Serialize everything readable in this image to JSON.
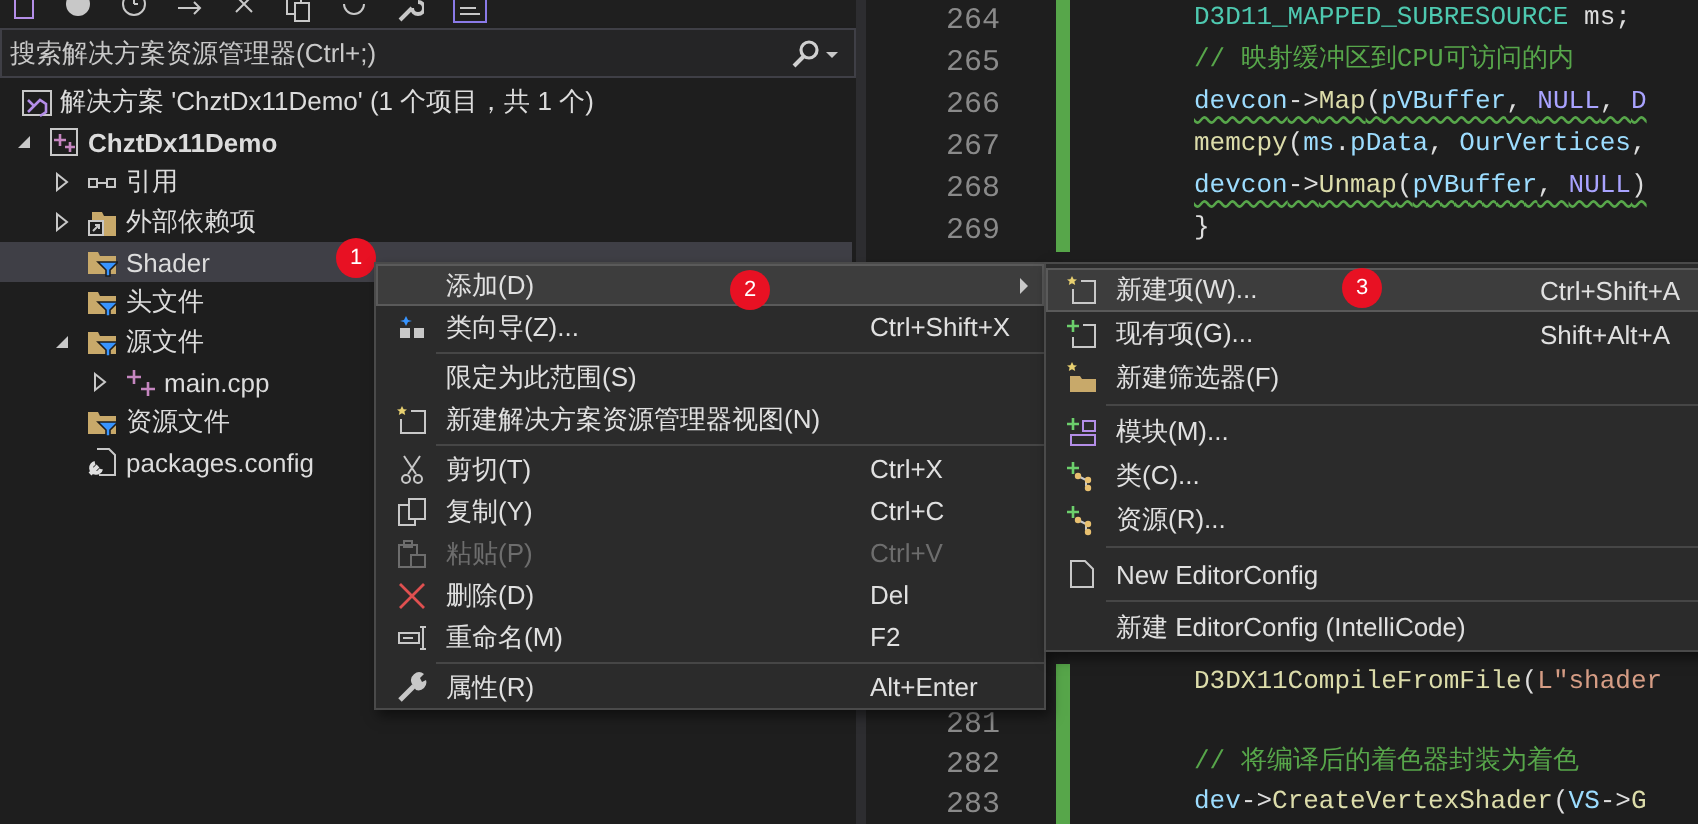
{
  "search": {
    "placeholder": "搜索解决方案资源管理器(Ctrl+;)"
  },
  "tree": [
    {
      "label": "解决方案 'ChztDx11Demo' (1 个项目，共 1 个)",
      "kind": "solution",
      "selected": false,
      "children": [
        {
          "label": "ChztDx11Demo",
          "kind": "project",
          "expanded": true,
          "selected": false,
          "children": [
            {
              "label": "引用",
              "kind": "references",
              "expanded": false,
              "selected": false
            },
            {
              "label": "外部依赖项",
              "kind": "external",
              "expanded": false,
              "selected": false
            },
            {
              "label": "Shader",
              "kind": "filter",
              "selected": true,
              "badge": "1"
            },
            {
              "label": "头文件",
              "kind": "filter",
              "selected": false
            },
            {
              "label": "源文件",
              "kind": "filter",
              "expanded": true,
              "selected": false,
              "children": [
                {
                  "label": "main.cpp",
                  "kind": "cpp",
                  "expanded": false,
                  "selected": false
                }
              ]
            },
            {
              "label": "资源文件",
              "kind": "filter",
              "selected": false
            },
            {
              "label": "packages.config",
              "kind": "config",
              "selected": false
            }
          ]
        }
      ]
    }
  ],
  "editor": {
    "blocks": [
      {
        "lines": [
          {
            "number": "264",
            "changed": true,
            "warning": false,
            "code": [
              {
                "kind": "type",
                "text": "D3D11_MAPPED_SUBRESOURCE"
              },
              {
                "kind": "plain",
                "text": " ms;"
              }
            ]
          },
          {
            "number": "265",
            "changed": true,
            "warning": false,
            "code": [
              {
                "kind": "comment",
                "text": "// 映射缓冲区到CPU可访问的内"
              }
            ]
          },
          {
            "number": "266",
            "changed": true,
            "warning": true,
            "code": [
              {
                "kind": "var",
                "text": "devcon"
              },
              {
                "kind": "plain",
                "text": "->"
              },
              {
                "kind": "func",
                "text": "Map"
              },
              {
                "kind": "plain",
                "text": "("
              },
              {
                "kind": "var",
                "text": "pVBuffer"
              },
              {
                "kind": "plain",
                "text": ", "
              },
              {
                "kind": "macro",
                "text": "NULL"
              },
              {
                "kind": "plain",
                "text": ", "
              },
              {
                "kind": "macro",
                "text": "D"
              }
            ]
          },
          {
            "number": "267",
            "changed": true,
            "warning": false,
            "code": [
              {
                "kind": "func",
                "text": "memcpy"
              },
              {
                "kind": "plain",
                "text": "("
              },
              {
                "kind": "var",
                "text": "ms"
              },
              {
                "kind": "plain",
                "text": "."
              },
              {
                "kind": "var",
                "text": "pData"
              },
              {
                "kind": "plain",
                "text": ", "
              },
              {
                "kind": "var",
                "text": "OurVertices"
              },
              {
                "kind": "plain",
                "text": ","
              }
            ]
          },
          {
            "number": "268",
            "changed": true,
            "warning": true,
            "code": [
              {
                "kind": "var",
                "text": "devcon"
              },
              {
                "kind": "plain",
                "text": "->"
              },
              {
                "kind": "func",
                "text": "Unmap"
              },
              {
                "kind": "plain",
                "text": "("
              },
              {
                "kind": "var",
                "text": "pVBuffer"
              },
              {
                "kind": "plain",
                "text": ", "
              },
              {
                "kind": "macro",
                "text": "NULL"
              },
              {
                "kind": "plain",
                "text": ")"
              }
            ]
          },
          {
            "number": "269",
            "changed": true,
            "warning": false,
            "code": [
              {
                "kind": "plain",
                "text": "}"
              }
            ]
          }
        ]
      },
      {
        "lines": [
          {
            "changed": true,
            "warning": false,
            "code": [
              {
                "kind": "func",
                "text": "D3DX11CompileFromFile"
              },
              {
                "kind": "plain",
                "text": "("
              },
              {
                "kind": "string",
                "text": "L\"shader"
              }
            ]
          },
          {
            "number": "281",
            "changed": true
          },
          {
            "number": "282",
            "changed": true,
            "warning": false,
            "code": [
              {
                "kind": "comment",
                "text": "// 将编译后的着色器封装为着色"
              }
            ]
          },
          {
            "number": "283",
            "changed": true,
            "warning": false,
            "code": [
              {
                "kind": "var",
                "text": "dev"
              },
              {
                "kind": "plain",
                "text": "->"
              },
              {
                "kind": "func",
                "text": "CreateVertexShader"
              },
              {
                "kind": "plain",
                "text": "("
              },
              {
                "kind": "var",
                "text": "VS"
              },
              {
                "kind": "plain",
                "text": "->"
              },
              {
                "kind": "func",
                "text": "G"
              }
            ]
          }
        ]
      }
    ]
  },
  "context_menu": {
    "items": [
      {
        "kind": "submenu",
        "label": "添加(D)",
        "selected": true,
        "disabled": false,
        "badge": "2"
      },
      {
        "kind": "item",
        "label": "类向导(Z)...",
        "shortcut": "Ctrl+Shift+X",
        "selected": false,
        "disabled": false
      },
      {
        "kind": "separator"
      },
      {
        "kind": "item",
        "label": "限定为此范围(S)",
        "selected": false,
        "disabled": false
      },
      {
        "kind": "item",
        "label": "新建解决方案资源管理器视图(N)",
        "selected": false,
        "disabled": false
      },
      {
        "kind": "separator"
      },
      {
        "kind": "item",
        "label": "剪切(T)",
        "shortcut": "Ctrl+X",
        "selected": false,
        "disabled": false
      },
      {
        "kind": "item",
        "label": "复制(Y)",
        "shortcut": "Ctrl+C",
        "selected": false,
        "disabled": false
      },
      {
        "kind": "item",
        "label": "粘贴(P)",
        "shortcut": "Ctrl+V",
        "selected": false,
        "disabled": true
      },
      {
        "kind": "item",
        "label": "删除(D)",
        "shortcut": "Del",
        "selected": false,
        "disabled": false
      },
      {
        "kind": "item",
        "label": "重命名(M)",
        "shortcut": "F2",
        "selected": false,
        "disabled": false
      },
      {
        "kind": "separator"
      },
      {
        "kind": "item",
        "label": "属性(R)",
        "shortcut": "Alt+Enter",
        "selected": false,
        "disabled": false
      }
    ]
  },
  "submenu": {
    "items": [
      {
        "kind": "item",
        "label": "新建项(W)...",
        "shortcut": "Ctrl+Shift+A",
        "selected": true,
        "disabled": false,
        "badge": "3"
      },
      {
        "kind": "item",
        "label": "现有项(G)...",
        "shortcut": "Shift+Alt+A",
        "selected": false,
        "disabled": false
      },
      {
        "kind": "item",
        "label": "新建筛选器(F)",
        "selected": false,
        "disabled": false
      },
      {
        "kind": "separator"
      },
      {
        "kind": "item",
        "label": "模块(M)...",
        "selected": false,
        "disabled": false
      },
      {
        "kind": "item",
        "label": "类(C)...",
        "selected": false,
        "disabled": false
      },
      {
        "kind": "item",
        "label": "资源(R)...",
        "selected": false,
        "disabled": false
      },
      {
        "kind": "separator"
      },
      {
        "kind": "item",
        "label": "New EditorConfig",
        "selected": false,
        "disabled": false
      },
      {
        "kind": "separator"
      },
      {
        "kind": "item",
        "label": "新建 EditorConfig (IntelliCode)",
        "selected": false,
        "disabled": false
      }
    ]
  }
}
